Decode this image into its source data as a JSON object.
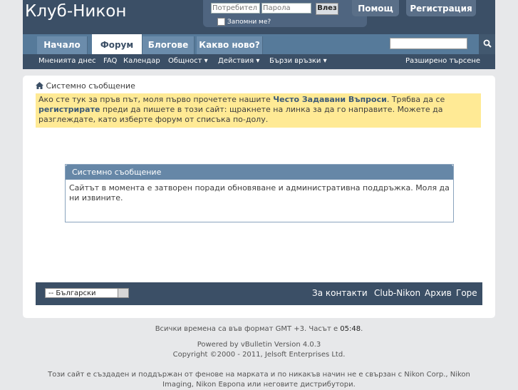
{
  "header": {
    "logo": "Клуб-Никон",
    "username_placeholder": "Потребител",
    "password_placeholder": "Парола",
    "login_button": "Влез",
    "remember_me": "Запомни ме?",
    "help_button": "Помощ",
    "register_button": "Регистрация"
  },
  "nav": {
    "tabs": [
      "Начало",
      "Форум",
      "Блогове",
      "Какво ново?"
    ],
    "active_tab": "Форум",
    "search_icon": "search-icon"
  },
  "subnav": {
    "items": [
      "Мненията днес",
      "FAQ",
      "Календар",
      "Общност ▾",
      "Действия ▾",
      "Бързи връзки ▾"
    ],
    "advanced_search": "Разширено търсене"
  },
  "breadcrumb": {
    "home_icon": "home-icon",
    "text": "Системно съобщение"
  },
  "notice": {
    "part1": "Ако сте тук за пръв път, моля първо прочетете нашите ",
    "faq_link": "Често Задавани Въпроси",
    "part2": ". Трябва да се ",
    "register_link": "регистрирате",
    "part3": " преди да пишете в този сайт: щракнете на линка за да го направите. Можете да разглеждате, като изберте форум от списъка по-долу."
  },
  "system_message": {
    "title": "Системно съобщение",
    "body": "Сайтът в момента е затворен поради обновяване и административна поддръжка. Моля да ни извините."
  },
  "footer_bar": {
    "language": "-- Български",
    "links": [
      "За контакти",
      "Club-Nikon",
      "Архив",
      "Горе"
    ]
  },
  "footer": {
    "timezone": "Всички времена са във формат GMT +3. Часът е",
    "time": "05:48",
    "time_suffix": ".",
    "powered": "Powered by vBulletin Version 4.0.3",
    "copyright": "Copyright ©2000 - 2011, Jelsoft Enterprises Ltd.",
    "disclaimer": "Този сайт е създаден и поддържан от фенове на марката и по никакъв начин не е свързан с Nikon Corp., Nikon Imaging, Nikon Европа или неговите дистрибутори."
  }
}
